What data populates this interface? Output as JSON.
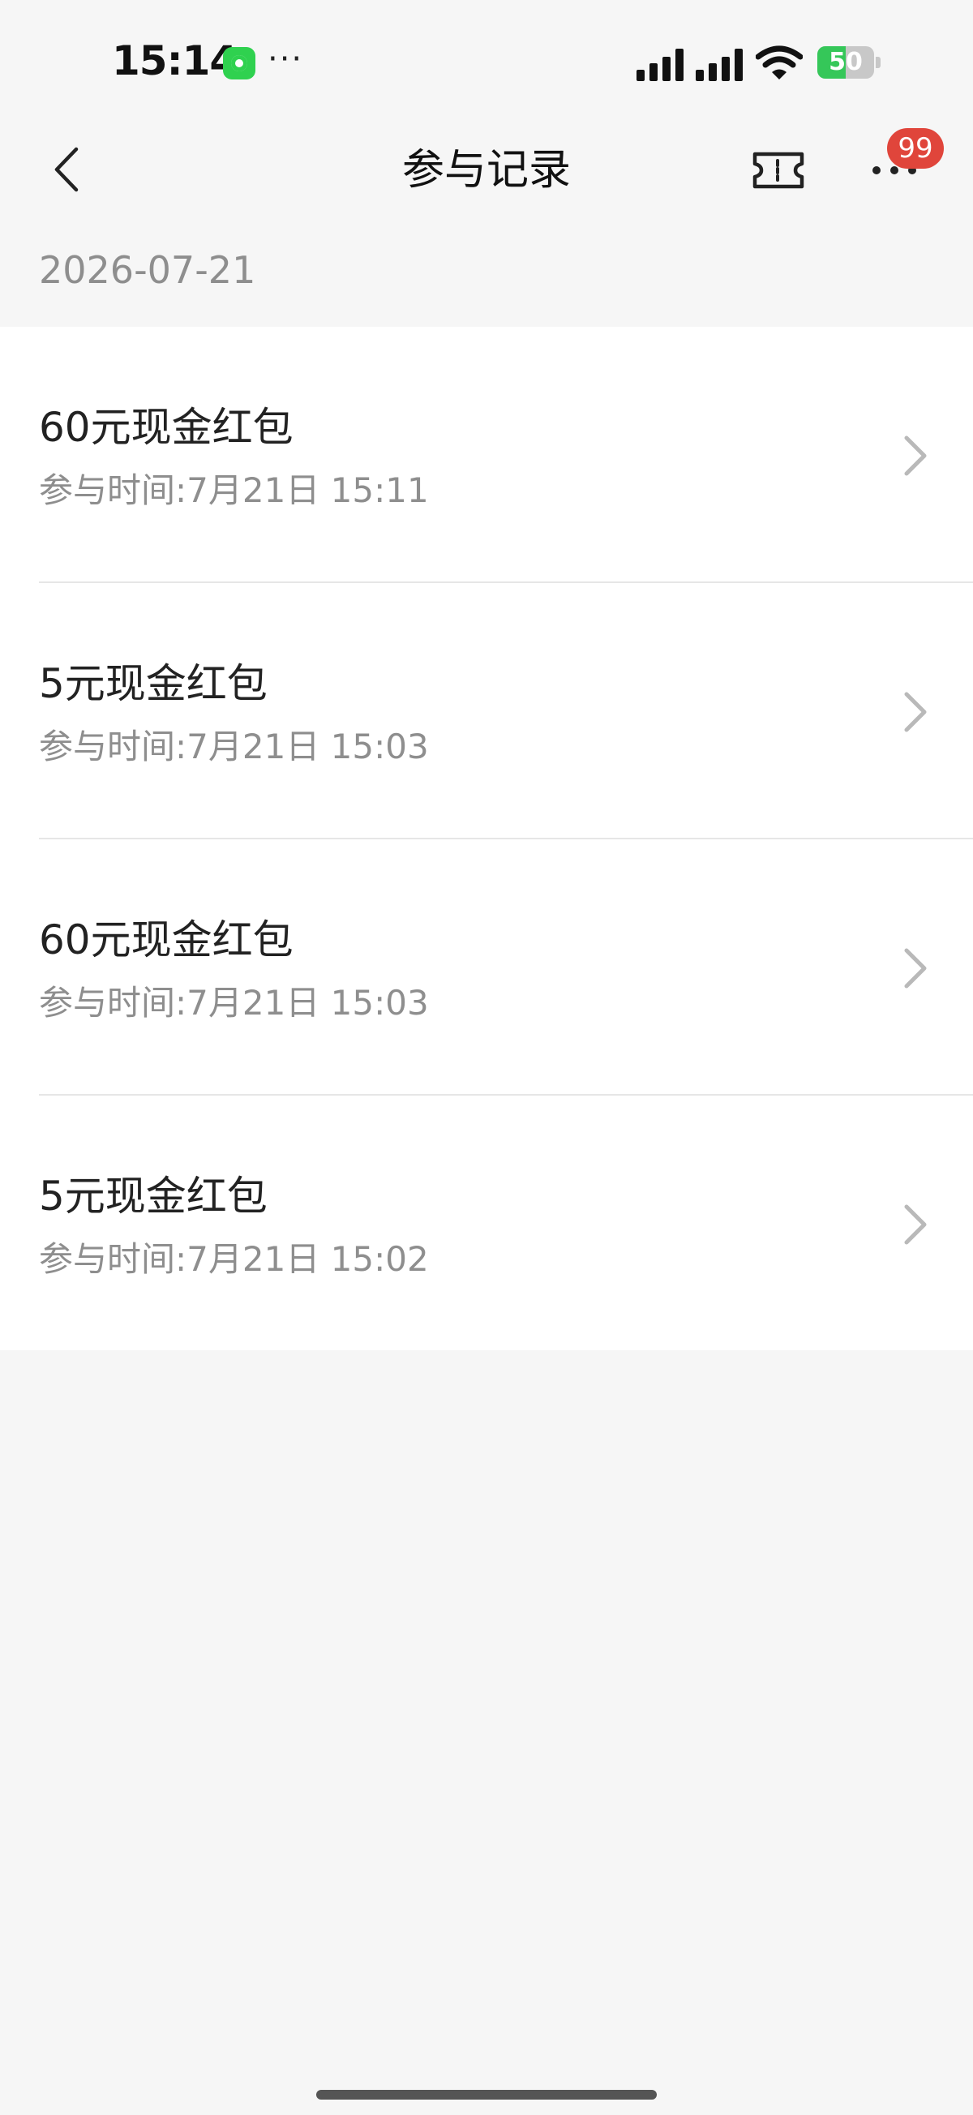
{
  "status_bar": {
    "time": "15:14",
    "more_label": "···",
    "battery_percent": 50,
    "battery_label": "50"
  },
  "nav": {
    "title": "参与记录",
    "badge_count": "99"
  },
  "date_header": "2026-07-21",
  "records": [
    {
      "title": "60元现金红包",
      "time": "参与时间:7月21日 15:11"
    },
    {
      "title": "5元现金红包",
      "time": "参与时间:7月21日 15:03"
    },
    {
      "title": "60元现金红包",
      "time": "参与时间:7月21日 15:03"
    },
    {
      "title": "5元现金红包",
      "time": "参与时间:7月21日 15:02"
    }
  ],
  "colors": {
    "background": "#f6f6f6",
    "badge": "#e0453b",
    "battery_green": "#35c759",
    "app_icon_green": "#2fd14f",
    "secondary_text": "#8e8e8e"
  },
  "icons": {
    "back": "chevron-left-icon",
    "ticket": "ticket-icon",
    "more": "more-dots-icon",
    "row_chevron": "chevron-right-icon",
    "wifi": "wifi-icon",
    "signal": "cellular-signal-icon",
    "battery": "battery-charging-icon"
  }
}
